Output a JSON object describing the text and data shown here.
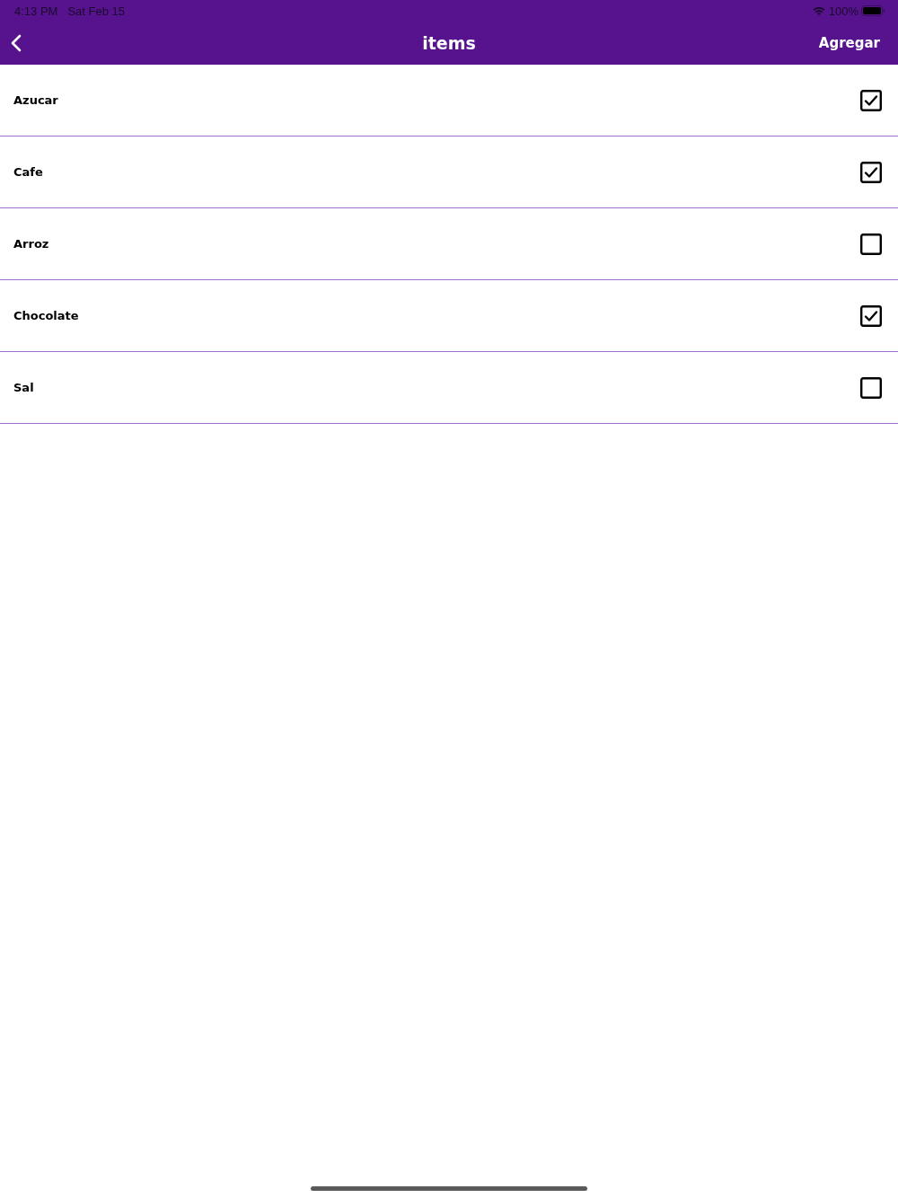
{
  "status_bar": {
    "time": "4:13 PM",
    "date": "Sat Feb 15",
    "battery": "100%"
  },
  "nav_bar": {
    "title": "items",
    "action": "Agregar"
  },
  "items": [
    {
      "label": "Azucar",
      "checked": true
    },
    {
      "label": "Cafe",
      "checked": true
    },
    {
      "label": "Arroz",
      "checked": false
    },
    {
      "label": "Chocolate",
      "checked": true
    },
    {
      "label": "Sal",
      "checked": false
    }
  ]
}
